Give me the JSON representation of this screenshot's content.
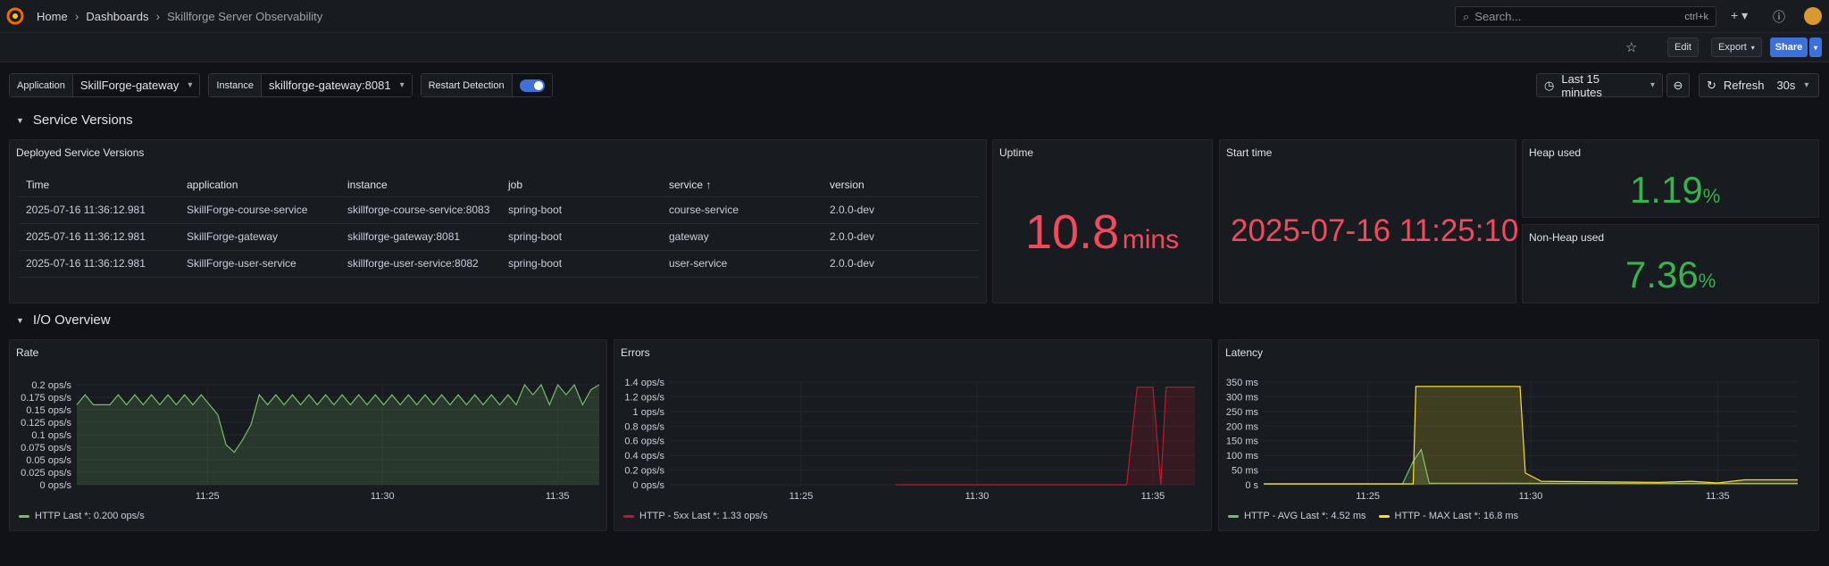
{
  "breadcrumb": {
    "home": "Home",
    "dashboards": "Dashboards",
    "current": "Skillforge Server Observability"
  },
  "search": {
    "placeholder": "Search...",
    "shortcut": "ctrl+k"
  },
  "toolbar": {
    "edit": "Edit",
    "export": "Export",
    "share": "Share"
  },
  "variables": [
    {
      "label": "Application",
      "value": "SkillForge-gateway"
    },
    {
      "label": "Instance",
      "value": "skillforge-gateway:8081"
    }
  ],
  "restart_detection": {
    "label": "Restart Detection",
    "enabled": true
  },
  "time": {
    "range": "Last 15 minutes",
    "refresh": "Refresh",
    "interval": "30s"
  },
  "rows": {
    "service_versions": "Service Versions",
    "io_overview": "I/O Overview"
  },
  "versions_panel": {
    "title": "Deployed Service Versions",
    "columns": [
      "Time",
      "application",
      "instance",
      "job",
      "service",
      "version"
    ],
    "sort_indicator": "↑",
    "rows": [
      [
        "2025-07-16 11:36:12.981",
        "SkillForge-course-service",
        "skillforge-course-service:8083",
        "spring-boot",
        "course-service",
        "2.0.0-dev"
      ],
      [
        "2025-07-16 11:36:12.981",
        "SkillForge-gateway",
        "skillforge-gateway:8081",
        "spring-boot",
        "gateway",
        "2.0.0-dev"
      ],
      [
        "2025-07-16 11:36:12.981",
        "SkillForge-user-service",
        "skillforge-user-service:8082",
        "spring-boot",
        "user-service",
        "2.0.0-dev"
      ]
    ]
  },
  "uptime": {
    "title": "Uptime",
    "value": "10.8",
    "unit": "mins"
  },
  "start_time": {
    "title": "Start time",
    "value": "2025-07-16 11:25:10"
  },
  "heap": {
    "title": "Heap used",
    "value": "1.19",
    "unit": "%"
  },
  "nonheap": {
    "title": "Non-Heap used",
    "value": "7.36",
    "unit": "%"
  },
  "colors": {
    "red": "#f2495c",
    "green": "#73bf69",
    "yellow": "#fade2a",
    "darkred": "#c4162a"
  },
  "chart_data": [
    {
      "type": "area",
      "title": "Rate",
      "x_ticks": [
        "11:25",
        "11:30",
        "11:35"
      ],
      "y_ticks": [
        "0.2 ops/s",
        "0.175 ops/s",
        "0.15 ops/s",
        "0.125 ops/s",
        "0.1 ops/s",
        "0.075 ops/s",
        "0.05 ops/s",
        "0.025 ops/s",
        "0 ops/s"
      ],
      "ylim": [
        0,
        0.2
      ],
      "series": [
        {
          "name": "HTTP",
          "legend": "HTTP  Last *: 0.200 ops/s",
          "color": "#73bf69",
          "values": [
            0.16,
            0.18,
            0.16,
            0.16,
            0.16,
            0.18,
            0.16,
            0.18,
            0.16,
            0.18,
            0.16,
            0.18,
            0.16,
            0.18,
            0.16,
            0.18,
            0.16,
            0.14,
            0.08,
            0.065,
            0.09,
            0.12,
            0.18,
            0.16,
            0.18,
            0.16,
            0.18,
            0.16,
            0.18,
            0.16,
            0.18,
            0.16,
            0.18,
            0.16,
            0.18,
            0.16,
            0.18,
            0.16,
            0.18,
            0.16,
            0.18,
            0.16,
            0.18,
            0.16,
            0.18,
            0.16,
            0.18,
            0.16,
            0.18,
            0.16,
            0.18,
            0.16,
            0.18,
            0.16,
            0.2,
            0.18,
            0.2,
            0.16,
            0.2,
            0.18,
            0.2,
            0.16,
            0.19,
            0.2
          ]
        }
      ]
    },
    {
      "type": "area",
      "title": "Errors",
      "x_ticks": [
        "11:25",
        "11:30",
        "11:35"
      ],
      "y_ticks": [
        "1.4 ops/s",
        "1.2 ops/s",
        "1 ops/s",
        "0.8 ops/s",
        "0.6 ops/s",
        "0.4 ops/s",
        "0.2 ops/s",
        "0 ops/s"
      ],
      "ylim": [
        0,
        1.4
      ],
      "series": [
        {
          "name": "HTTP - 5xx",
          "legend": "HTTP - 5xx  Last *: 1.33 ops/s",
          "color": "#c4162a",
          "points": [
            [
              0.43,
              0
            ],
            [
              0.87,
              0
            ],
            [
              0.89,
              1.33
            ],
            [
              0.92,
              1.33
            ],
            [
              0.935,
              0
            ],
            [
              0.945,
              1.33
            ],
            [
              1.0,
              1.33
            ]
          ]
        }
      ]
    },
    {
      "type": "line",
      "title": "Latency",
      "x_ticks": [
        "11:25",
        "11:30",
        "11:35"
      ],
      "y_ticks": [
        "350 ms",
        "300 ms",
        "250 ms",
        "200 ms",
        "150 ms",
        "100 ms",
        "50 ms",
        "0 s"
      ],
      "ylim": [
        0,
        350
      ],
      "series": [
        {
          "name": "HTTP - AVG",
          "legend": "HTTP - AVG  Last *: 4.52 ms",
          "color": "#73bf69",
          "points": [
            [
              0,
              3
            ],
            [
              0.26,
              3
            ],
            [
              0.28,
              80
            ],
            [
              0.295,
              120
            ],
            [
              0.31,
              5
            ],
            [
              1.0,
              4.5
            ]
          ]
        },
        {
          "name": "HTTP - MAX",
          "legend": "HTTP - MAX  Last *: 16.8 ms",
          "color": "#fade2a",
          "points": [
            [
              0,
              3
            ],
            [
              0.28,
              3
            ],
            [
              0.285,
              335
            ],
            [
              0.48,
              335
            ],
            [
              0.49,
              40
            ],
            [
              0.52,
              12
            ],
            [
              0.74,
              8
            ],
            [
              0.8,
              12
            ],
            [
              0.85,
              6
            ],
            [
              0.9,
              16.8
            ],
            [
              1.0,
              16.8
            ]
          ]
        }
      ]
    }
  ]
}
